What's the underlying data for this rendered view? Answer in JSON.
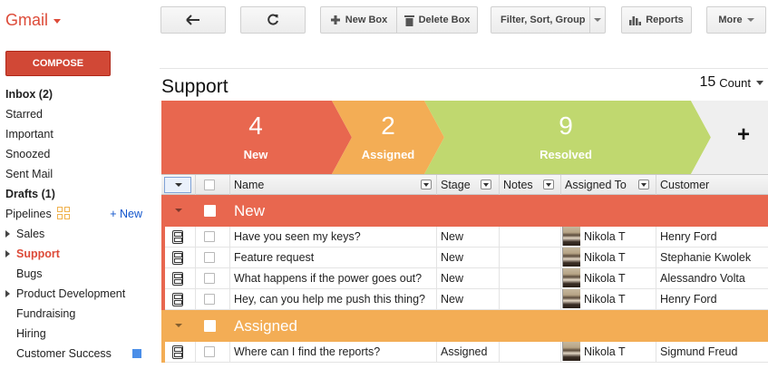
{
  "app": {
    "logo_text": "Gmail",
    "compose_label": "COMPOSE",
    "accent_color": "#dd4b39"
  },
  "sidebar": {
    "items": [
      {
        "label": "Inbox (2)"
      },
      {
        "label": "Starred"
      },
      {
        "label": "Important"
      },
      {
        "label": "Snoozed"
      },
      {
        "label": "Sent Mail"
      },
      {
        "label": "Drafts (1)"
      },
      {
        "label": "Pipelines",
        "action": "+ New"
      },
      {
        "label": "Sales"
      },
      {
        "label": "Support"
      },
      {
        "label": "Bugs"
      },
      {
        "label": "Product Development"
      },
      {
        "label": "Fundraising"
      },
      {
        "label": "Hiring"
      },
      {
        "label": "Customer Success"
      }
    ]
  },
  "toolbar": {
    "back_icon": "back-arrow-icon",
    "refresh_icon": "refresh-icon",
    "new_box_label": "New Box",
    "delete_box_label": "Delete Box",
    "filter_label": "Filter, Sort, Group",
    "reports_label": "Reports",
    "more_label": "More"
  },
  "box": {
    "title": "Support",
    "count_value": "15",
    "count_label": "Count"
  },
  "stages": [
    {
      "count": "4",
      "name": "New",
      "color": "#e8674f"
    },
    {
      "count": "2",
      "name": "Assigned",
      "color": "#f3ad55"
    },
    {
      "count": "9",
      "name": "Resolved",
      "color": "#c0d86f"
    }
  ],
  "add_stage_label": "+",
  "table": {
    "columns": [
      "Name",
      "Stage",
      "Notes",
      "Assigned To",
      "Customer"
    ],
    "groups": [
      {
        "name": "New",
        "color": "#e8674f",
        "rows": [
          {
            "name": "Have you seen my keys?",
            "stage": "New",
            "notes": "",
            "assigned_to": "Nikola T",
            "customer": "Henry Ford"
          },
          {
            "name": "Feature request",
            "stage": "New",
            "notes": "",
            "assigned_to": "Nikola T",
            "customer": "Stephanie Kwolek"
          },
          {
            "name": "What happens if the power goes out?",
            "stage": "New",
            "notes": "",
            "assigned_to": "Nikola T",
            "customer": "Alessandro Volta"
          },
          {
            "name": "Hey, can you help me push this thing?",
            "stage": "New",
            "notes": "",
            "assigned_to": "Nikola T",
            "customer": "Henry Ford"
          }
        ]
      },
      {
        "name": "Assigned",
        "color": "#f3ad55",
        "rows": [
          {
            "name": "Where can I find the reports?",
            "stage": "Assigned",
            "notes": "",
            "assigned_to": "Nikola T",
            "customer": "Sigmund Freud"
          }
        ]
      }
    ]
  }
}
